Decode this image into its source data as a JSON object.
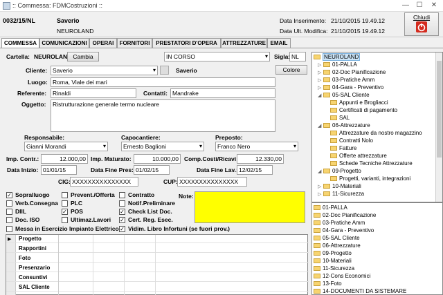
{
  "window": {
    "title": ":: Commessa: FDMCostruzioni ::",
    "min": "—",
    "max": "☐",
    "close": "✕"
  },
  "header": {
    "code": "0032/15/NL",
    "name": "Saverio",
    "company": "NEUROLAND",
    "date_insert_label": "Data Inserimento:",
    "date_insert_value": "21/10/2015 19.49.12",
    "date_mod_label": "Data Ult. Modifica:",
    "date_mod_value": "21/10/2015 19.49.12",
    "close_label": "Chiudi"
  },
  "tabs": [
    "COMMESSA",
    "COMUNICAZIONI",
    "OPERAI",
    "FORNITORI",
    "PRESTATORI D'OPERA",
    "ATTREZZATURE",
    "EMAIL"
  ],
  "form": {
    "cartella_label": "Cartella:",
    "cartella_value": "NEUROLAND",
    "cambia_label": "Cambia",
    "stato_value": "IN CORSO",
    "sigla_label": "Sigla:",
    "sigla_value": "NL",
    "cliente_label": "Cliente:",
    "cliente_value": "Saverio",
    "cliente_name": "Saverio",
    "colore_label": "Colore",
    "luogo_label": "Luogo:",
    "luogo_value": "Roma, Viale dei mari",
    "referente_label": "Referente:",
    "referente_value": "Rinaldi",
    "contatti_label": "Contatti:",
    "contatti_value": "Mandrake",
    "oggetto_label": "Oggetto:",
    "oggetto_value": "Ristrutturazione generale termo nucleare",
    "responsabile_label": "Responsabile:",
    "responsabile_value": "Gianni Morandi",
    "capocantiere_label": "Capocantiere:",
    "capocantiere_value": "Ernesto Baglioni",
    "preposto_label": "Preposto:",
    "preposto_value": "Franco Nero",
    "imp_contr_label": "Imp. Contr.:",
    "imp_contr_value": "12.000,00",
    "imp_mat_label": "Imp. Maturato:",
    "imp_mat_value": "10.000,00",
    "comp_label": "Comp.Costi/Ricavi:",
    "comp_value": "12.330,00",
    "data_inizio_label": "Data Inizio:",
    "data_inizio_value": "01/01/15",
    "data_fine_pres_label": "Data Fine Pres:",
    "data_fine_pres_value": "01/02/15",
    "data_fine_lav_label": "Data Fine Lav.:",
    "data_fine_lav_value": "12/02/15",
    "cig_label": "CIG:",
    "cig_value": "XXXXXXXXXXXXXXX",
    "cup_label": "CUP:",
    "cup_value": "XXXXXXXXXXXXXXX",
    "note_label": "Note:",
    "note_color": "#ffff00"
  },
  "checks": [
    {
      "label": "Sopralluogo",
      "checked": true
    },
    {
      "label": "Prevent./Offerta",
      "checked": false
    },
    {
      "label": "Contratto",
      "checked": false
    },
    {
      "label": "Verb.Consegna",
      "checked": false
    },
    {
      "label": "PLC",
      "checked": false
    },
    {
      "label": "Notif.Preliminare",
      "checked": false
    },
    {
      "label": "DIIL",
      "checked": false
    },
    {
      "label": "POS",
      "checked": true
    },
    {
      "label": "Check List Doc.",
      "checked": true
    },
    {
      "label": "Doc. ISO",
      "checked": false
    },
    {
      "label": "Ultimaz.Lavori",
      "checked": false
    },
    {
      "label": "Cert. Reg. Esec.",
      "checked": true
    },
    {
      "label": "Messa in Esercizio Impianto Elettrico",
      "checked": false
    },
    {
      "label": "Vidim. Libro Infortuni (se fuori prov.)",
      "checked": true
    }
  ],
  "grid_rows": [
    "Progetto",
    "Rapportini",
    "Foto",
    "Presenzario",
    "Consuntivi",
    "SAL Cliente"
  ],
  "tree": [
    {
      "label": "NEUROLAND",
      "level": 0,
      "exp": "",
      "selected": true
    },
    {
      "label": "01-PALLA",
      "level": 1,
      "exp": "▷"
    },
    {
      "label": "02-Doc Pianificazione",
      "level": 1,
      "exp": "▷"
    },
    {
      "label": "03-Pratiche Amm",
      "level": 1,
      "exp": "▷"
    },
    {
      "label": "04-Gara - Preventivo",
      "level": 1,
      "exp": "▷"
    },
    {
      "label": "05-SAL Cliente",
      "level": 1,
      "exp": "◢"
    },
    {
      "label": "Appunti e Brogliacci",
      "level": 2,
      "exp": ""
    },
    {
      "label": "Certificati di pagamento",
      "level": 2,
      "exp": ""
    },
    {
      "label": "SAL",
      "level": 2,
      "exp": ""
    },
    {
      "label": "06-Attrezzature",
      "level": 1,
      "exp": "◢"
    },
    {
      "label": "Attrezzature da nostro magazzino",
      "level": 2,
      "exp": ""
    },
    {
      "label": "Contratti Nolo",
      "level": 2,
      "exp": ""
    },
    {
      "label": "Fatture",
      "level": 2,
      "exp": ""
    },
    {
      "label": "Offerte attrezzature",
      "level": 2,
      "exp": ""
    },
    {
      "label": "Schede Tecniche Attrezzature",
      "level": 2,
      "exp": ""
    },
    {
      "label": "09-Progetto",
      "level": 1,
      "exp": "◢"
    },
    {
      "label": "Progetti, varianti, integrazioni",
      "level": 2,
      "exp": ""
    },
    {
      "label": "10-Materiali",
      "level": 1,
      "exp": "▷"
    },
    {
      "label": "11-Sicurezza",
      "level": 1,
      "exp": "▷"
    }
  ],
  "list2": [
    "01-PALLA",
    "02-Doc Pianificazione",
    "03-Pratiche Amm",
    "04-Gara - Preventivo",
    "05-SAL Cliente",
    "06-Attrezzature",
    "09-Progetto",
    "10-Materiali",
    "11-Sicurezza",
    "12-Cons Economici",
    "13-Foto",
    "14-DOCUMENTI DA SISTEMARE"
  ]
}
